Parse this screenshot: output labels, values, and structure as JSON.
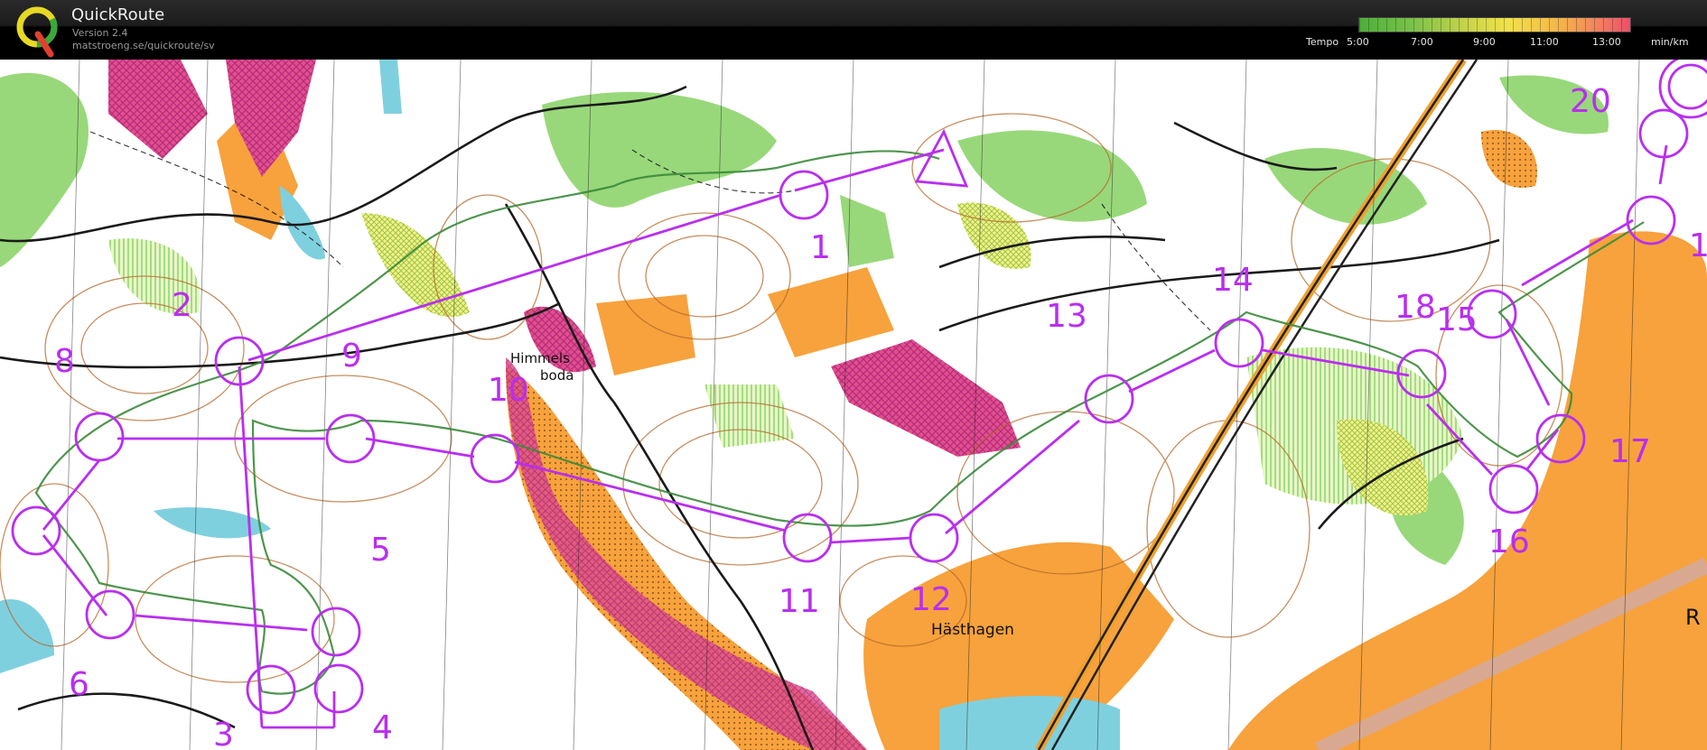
{
  "app": {
    "title": "QuickRoute",
    "version": "Version 2.4",
    "url": "matstroeng.se/quickroute/sv"
  },
  "tempo": {
    "label": "Tempo",
    "ticks": [
      "5:00",
      "7:00",
      "9:00",
      "11:00",
      "13:00"
    ],
    "unit": "min/km"
  },
  "map": {
    "places": [
      "Himmels",
      "boda",
      "Hästhagen",
      "R"
    ],
    "controls": [
      "1",
      "2",
      "3",
      "4",
      "5",
      "6",
      "8",
      "9",
      "10",
      "11",
      "12",
      "13",
      "14",
      "15",
      "16",
      "17",
      "18",
      "20",
      "1"
    ]
  },
  "colors": {
    "course": "#b92ef0",
    "forest_green": "#8dd46b",
    "open_yellow": "#f7a23c",
    "pink": "#e0508a",
    "water": "#7fd0df",
    "contour": "#b5682a"
  }
}
